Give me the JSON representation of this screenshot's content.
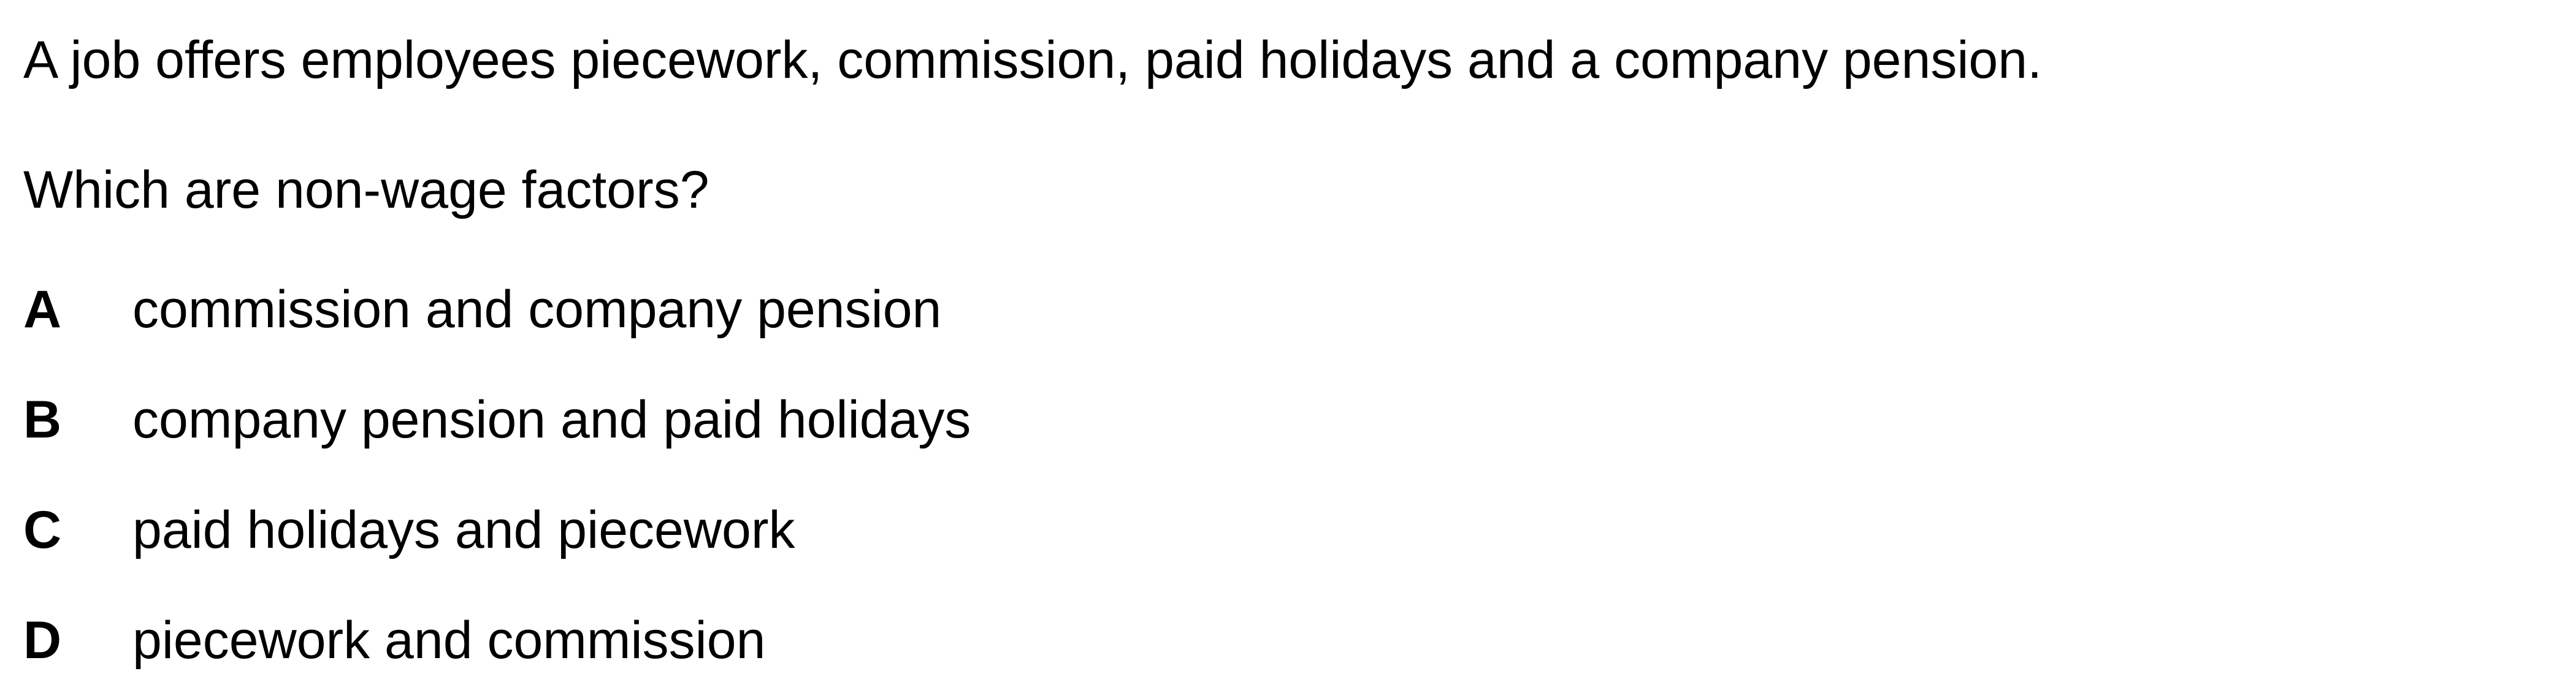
{
  "question": {
    "stem": "A job offers employees piecework, commission, paid holidays and a company pension.",
    "prompt": "Which are non-wage factors?",
    "options": [
      {
        "letter": "A",
        "text": "commission and company pension"
      },
      {
        "letter": "B",
        "text": "company pension and paid holidays"
      },
      {
        "letter": "C",
        "text": "paid holidays and piecework"
      },
      {
        "letter": "D",
        "text": "piecework and commission"
      }
    ]
  }
}
